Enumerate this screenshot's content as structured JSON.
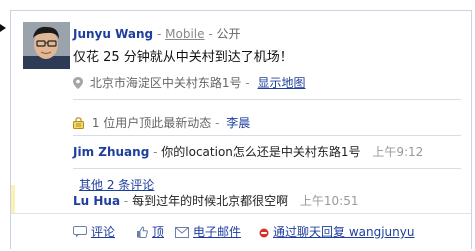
{
  "post": {
    "author": "Junyu Wang",
    "separator": "-",
    "source": "Mobile",
    "visibility_sep": "-",
    "visibility": "公开",
    "text": "仅花 25 分钟就从中关村到达了机场！",
    "location": "北京市海淀区中关村东路1号",
    "location_sep": "-",
    "map_link": "显示地图"
  },
  "likes": {
    "text": "1 位用户顶此最新动态",
    "sep": "-",
    "user": "李晨"
  },
  "comments": [
    {
      "author": "Jim Zhuang",
      "sep": "-",
      "text": "你的location怎么还是中关村东路1号",
      "time": "上午9:12"
    },
    {
      "author": "Lu Hua",
      "sep": "-",
      "text": "每到过年的时候北京都很空啊",
      "time": "上午10:51"
    }
  ],
  "more_comments": "其他 2 条评论",
  "actions": {
    "comment": "评论",
    "top": "顶",
    "email": "电子邮件",
    "chat_reply": "通过聊天回复 wangjunyu"
  },
  "icons": {
    "pin": "map-pin-icon",
    "like": "lock-icon",
    "comment": "comment-icon",
    "top": "thumb-up-icon",
    "email": "email-icon",
    "chat": "chat-status-icon"
  },
  "colors": {
    "link": "#1f3f9e",
    "border": "#c9d3e6",
    "highlight": "#fbf1b5"
  }
}
